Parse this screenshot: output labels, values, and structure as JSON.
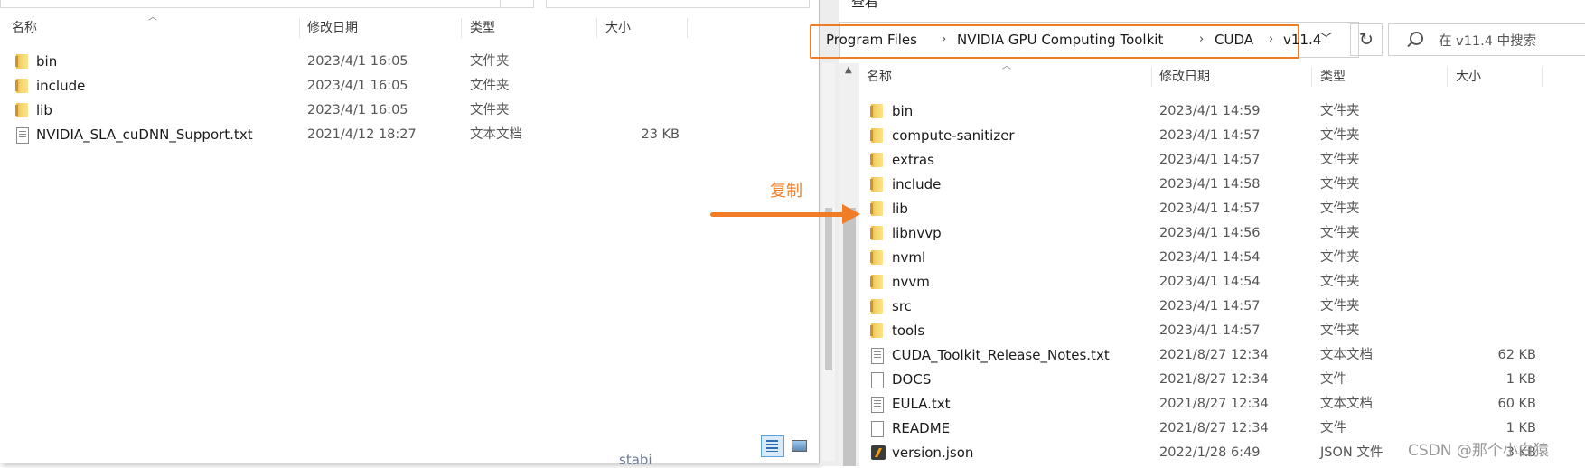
{
  "left_window": {
    "columns": {
      "name": "名称",
      "date": "修改日期",
      "type": "类型",
      "size": "大小"
    },
    "rows": [
      {
        "icon": "folder-icon",
        "name": "bin",
        "date": "2023/4/1 16:05",
        "type": "文件夹",
        "size": ""
      },
      {
        "icon": "folder-icon",
        "name": "include",
        "date": "2023/4/1 16:05",
        "type": "文件夹",
        "size": ""
      },
      {
        "icon": "folder-icon",
        "name": "lib",
        "date": "2023/4/1 16:05",
        "type": "文件夹",
        "size": ""
      },
      {
        "icon": "text-file-icon",
        "name": "NVIDIA_SLA_cuDNN_Support.txt",
        "date": "2021/4/12 18:27",
        "type": "文本文档",
        "size": "23 KB"
      }
    ],
    "background_text": "stabi"
  },
  "right_window": {
    "menu_view": "查看",
    "breadcrumbs": [
      "Program Files",
      "NVIDIA GPU Computing Toolkit",
      "CUDA",
      "v11.4"
    ],
    "search_placeholder": "在 v11.4 中搜索",
    "columns": {
      "name": "名称",
      "date": "修改日期",
      "type": "类型",
      "size": "大小"
    },
    "rows": [
      {
        "icon": "folder-icon",
        "name": "bin",
        "date": "2023/4/1 14:59",
        "type": "文件夹",
        "size": ""
      },
      {
        "icon": "folder-icon",
        "name": "compute-sanitizer",
        "date": "2023/4/1 14:57",
        "type": "文件夹",
        "size": ""
      },
      {
        "icon": "folder-icon",
        "name": "extras",
        "date": "2023/4/1 14:57",
        "type": "文件夹",
        "size": ""
      },
      {
        "icon": "folder-icon",
        "name": "include",
        "date": "2023/4/1 14:58",
        "type": "文件夹",
        "size": ""
      },
      {
        "icon": "folder-icon",
        "name": "lib",
        "date": "2023/4/1 14:57",
        "type": "文件夹",
        "size": ""
      },
      {
        "icon": "folder-icon",
        "name": "libnvvp",
        "date": "2023/4/1 14:56",
        "type": "文件夹",
        "size": ""
      },
      {
        "icon": "folder-icon",
        "name": "nvml",
        "date": "2023/4/1 14:54",
        "type": "文件夹",
        "size": ""
      },
      {
        "icon": "folder-icon",
        "name": "nvvm",
        "date": "2023/4/1 14:54",
        "type": "文件夹",
        "size": ""
      },
      {
        "icon": "folder-icon",
        "name": "src",
        "date": "2023/4/1 14:57",
        "type": "文件夹",
        "size": ""
      },
      {
        "icon": "folder-icon",
        "name": "tools",
        "date": "2023/4/1 14:57",
        "type": "文件夹",
        "size": ""
      },
      {
        "icon": "text-file-icon",
        "name": "CUDA_Toolkit_Release_Notes.txt",
        "date": "2021/8/27 12:34",
        "type": "文本文档",
        "size": "62 KB"
      },
      {
        "icon": "blank-file-icon",
        "name": "DOCS",
        "date": "2021/8/27 12:34",
        "type": "文件",
        "size": "1 KB"
      },
      {
        "icon": "text-file-icon",
        "name": "EULA.txt",
        "date": "2021/8/27 12:34",
        "type": "文本文档",
        "size": "60 KB"
      },
      {
        "icon": "blank-file-icon",
        "name": "README",
        "date": "2021/8/27 12:34",
        "type": "文件",
        "size": "1 KB"
      },
      {
        "icon": "json-file-icon",
        "name": "version.json",
        "date": "2022/1/28 6:49",
        "type": "JSON 文件",
        "size": "3 KB"
      }
    ]
  },
  "annotation": {
    "label": "复制",
    "color": "#f07c26"
  },
  "watermark": "CSDN @那个小白猿"
}
